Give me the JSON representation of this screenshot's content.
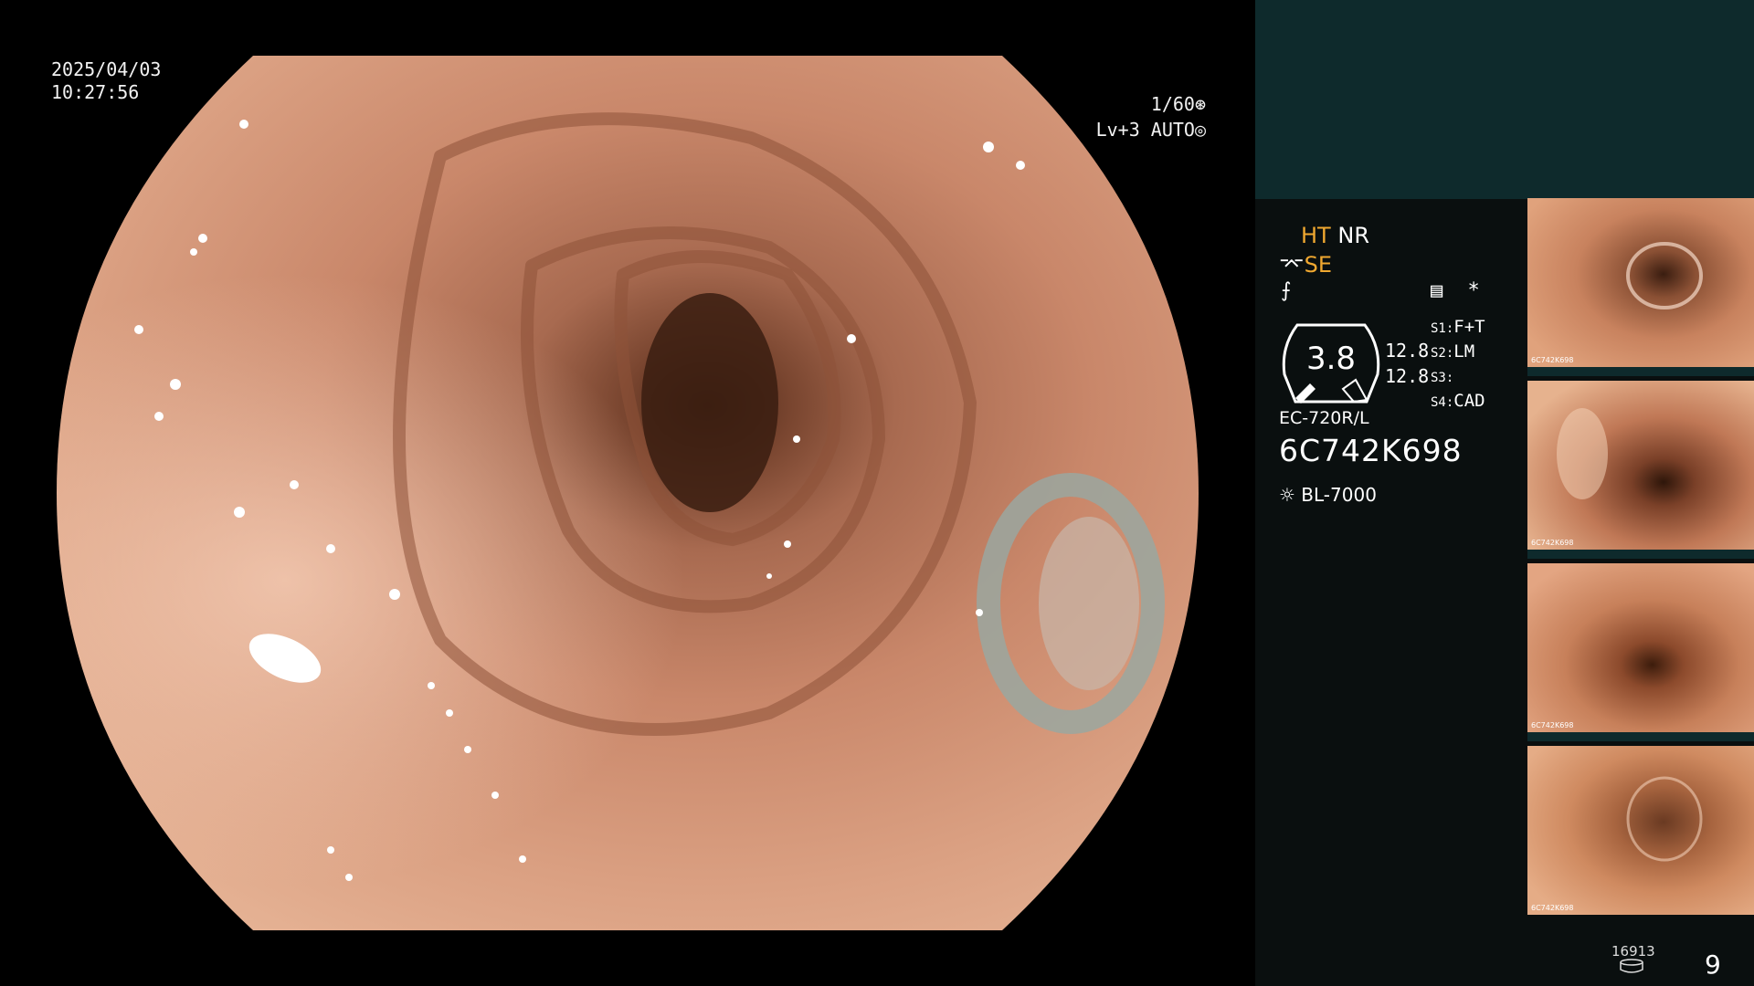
{
  "overlay": {
    "date": "2025/04/03",
    "time": "10:27:56",
    "shutter": "1/60",
    "level_auto": "Lv+3 AUTO"
  },
  "panel": {
    "ht": "HT",
    "nr": "NR",
    "se": "SE",
    "gauge_value": "3.8",
    "gauge_side_top": "12.8",
    "gauge_side_bottom": "12.8",
    "s1_label": "S1:",
    "s1_value": "F+T",
    "s2_label": "S2:",
    "s2_value": "LM",
    "s3_label": "S3:",
    "s3_value": "",
    "s4_label": "S4:",
    "s4_value": "CAD",
    "scope_model": "EC-720R/L",
    "scope_serial": "6C742K698",
    "light_source": "BL-7000",
    "asterisk": "*"
  },
  "thumbnails": {
    "thumb_label": "6C742K698"
  },
  "footer": {
    "storage_count": "16913",
    "image_count": "9"
  },
  "colors": {
    "accent_orange": "#f0a830",
    "panel_teal": "#0e2a2c",
    "tissue": "#c88a6c"
  }
}
